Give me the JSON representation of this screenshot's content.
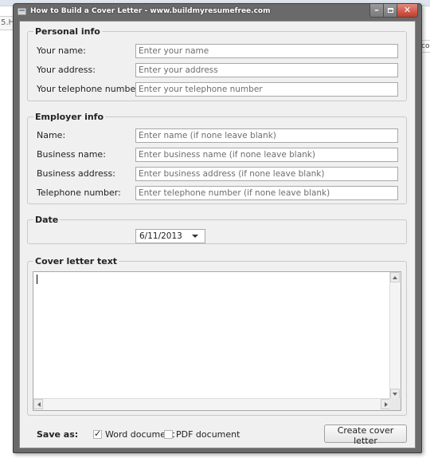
{
  "window": {
    "title": "How to Build a Cover Letter - www.buildmyresumefree.com"
  },
  "personal": {
    "legend": "Personal info",
    "fields": [
      {
        "label": "Your name:",
        "placeholder": "Enter your name"
      },
      {
        "label": "Your address:",
        "placeholder": "Enter your address"
      },
      {
        "label": "Your telephone number:",
        "placeholder": "Enter your telephone number"
      }
    ]
  },
  "employer": {
    "legend": "Employer info",
    "fields": [
      {
        "label": "Name:",
        "placeholder": "Enter name (if none leave blank)"
      },
      {
        "label": "Business name:",
        "placeholder": "Enter business name (if none leave blank)"
      },
      {
        "label": "Business address:",
        "placeholder": "Enter business address (if none leave blank)"
      },
      {
        "label": "Telephone number:",
        "placeholder": "Enter telephone number (if none leave blank)"
      }
    ]
  },
  "date": {
    "legend": "Date",
    "value": "6/11/2013"
  },
  "cover": {
    "legend": "Cover letter text",
    "text": ""
  },
  "save": {
    "label": "Save as:",
    "word_label": "Word document",
    "word_checked": true,
    "pdf_label": "PDF document",
    "pdf_checked": false
  },
  "create_button": "Create cover letter",
  "background": {
    "left_tab_text": "5.H",
    "right_tab_text": "co"
  }
}
